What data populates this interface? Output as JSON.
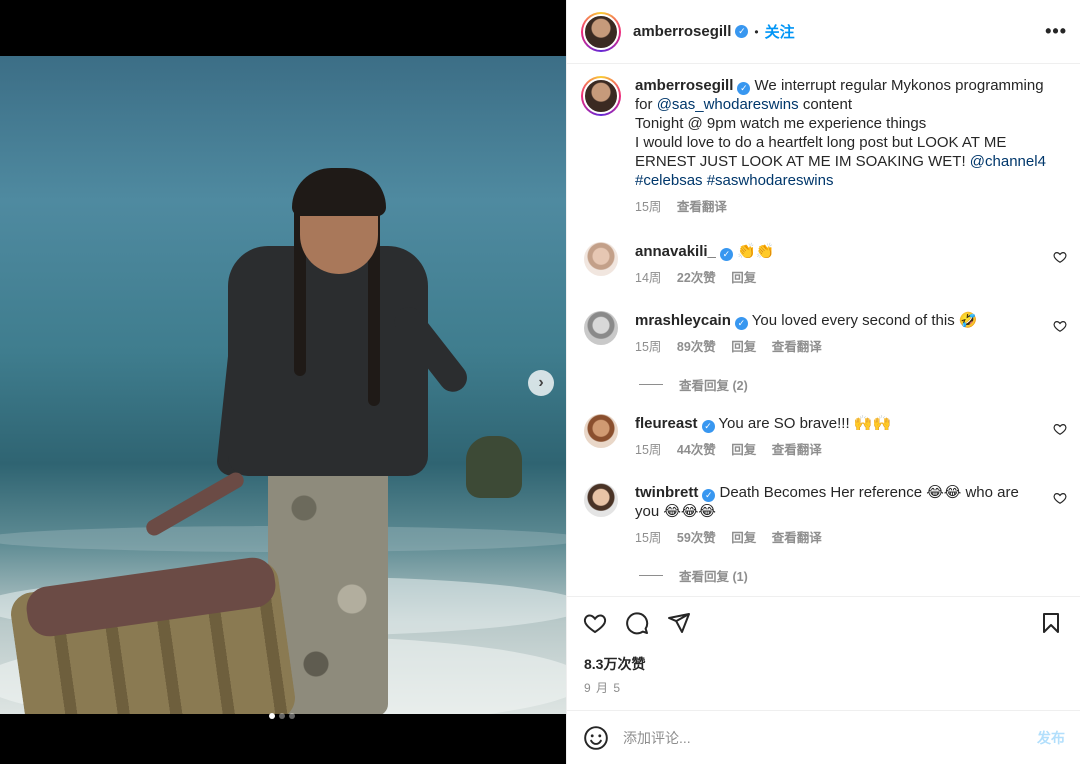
{
  "header": {
    "username": "amberrosegill",
    "separator": "•",
    "follow_label": "关注",
    "more_label": "•••"
  },
  "caption": {
    "username": "amberrosegill",
    "text_1": " We interrupt regular Mykonos programming for ",
    "mention_1": "@sas_whodareswins",
    "text_2": " content",
    "line_2": "Tonight @ 9pm watch me experience things",
    "line_3": "I would love to do a heartfelt long post but LOOK AT ME ERNEST JUST LOOK AT ME IM SOAKING WET! ",
    "mention_2": "@channel4",
    "tag_1": "#celebsas",
    "tag_2": "#saswhodareswins",
    "time": "15周",
    "translate": "查看翻译"
  },
  "comments": [
    {
      "username": "annavakili_",
      "text": " 👏👏",
      "time": "14周",
      "likes": "22次赞",
      "reply": "回复",
      "translate": ""
    },
    {
      "username": "mrashleycain",
      "text": " You loved every second of this 🤣",
      "time": "15周",
      "likes": "89次赞",
      "reply": "回复",
      "translate": "查看翻译",
      "view_replies": "查看回复 (2)"
    },
    {
      "username": "fleureast",
      "text": " You are SO brave!!! 🙌🙌",
      "time": "15周",
      "likes": "44次赞",
      "reply": "回复",
      "translate": "查看翻译"
    },
    {
      "username": "twinbrett",
      "text": " Death Becomes Her reference 😂😂 who are you 😂😂😂",
      "time": "15周",
      "likes": "59次赞",
      "reply": "回复",
      "translate": "查看翻译",
      "view_replies": "查看回复 (1)"
    }
  ],
  "actions": {
    "likes": "8.3万次赞",
    "date": "9 月 5"
  },
  "comment_box": {
    "placeholder": "添加评论...",
    "post_label": "发布"
  },
  "media": {
    "next_label": "›",
    "slide_count": 3,
    "current_slide": 1
  },
  "colors": {
    "accent": "#0095f6",
    "verified": "#3897f0",
    "muted": "#8e8e8e"
  },
  "icons": [
    "verified-icon",
    "more-icon",
    "heart-icon",
    "comment-icon",
    "share-icon",
    "bookmark-icon",
    "emoji-icon",
    "chevron-right-icon"
  ]
}
